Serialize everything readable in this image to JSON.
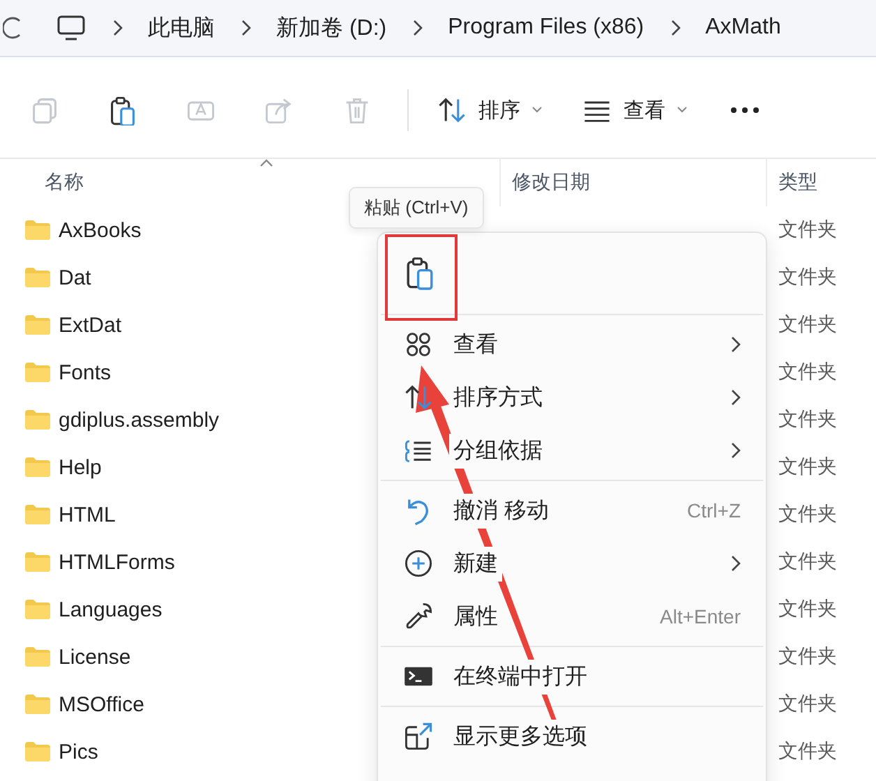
{
  "address_bar": {
    "crumbs": [
      "此电脑",
      "新加卷 (D:)",
      "Program Files (x86)",
      "AxMath"
    ]
  },
  "toolbar": {
    "items": [
      {
        "kind": "copy",
        "disabled": true
      },
      {
        "kind": "paste",
        "disabled": false
      },
      {
        "kind": "rename",
        "disabled": true
      },
      {
        "kind": "share",
        "disabled": true
      },
      {
        "kind": "delete",
        "disabled": true
      },
      {
        "kind": "sort",
        "label": "排序"
      },
      {
        "kind": "view",
        "label": "查看"
      },
      {
        "kind": "more"
      }
    ]
  },
  "columns": [
    {
      "label": "名称",
      "sorted": true
    },
    {
      "label": "修改日期",
      "sorted": false
    },
    {
      "label": "类型",
      "sorted": false
    }
  ],
  "files": [
    {
      "name": "AxBooks",
      "type": "文件夹"
    },
    {
      "name": "Dat",
      "type": "文件夹"
    },
    {
      "name": "ExtDat",
      "type": "文件夹"
    },
    {
      "name": "Fonts",
      "type": "文件夹"
    },
    {
      "name": "gdiplus.assembly",
      "type": "文件夹"
    },
    {
      "name": "Help",
      "type": "文件夹"
    },
    {
      "name": "HTML",
      "type": "文件夹"
    },
    {
      "name": "HTMLForms",
      "type": "文件夹"
    },
    {
      "name": "Languages",
      "type": "文件夹"
    },
    {
      "name": "License",
      "type": "文件夹"
    },
    {
      "name": "MSOffice",
      "type": "文件夹"
    },
    {
      "name": "Pics",
      "type": "文件夹"
    }
  ],
  "tooltip": "粘贴 (Ctrl+V)",
  "context_menu": {
    "top_icons": [
      {
        "kind": "paste"
      }
    ],
    "groups": [
      [
        {
          "kind": "view",
          "label": "查看",
          "submenu": true
        },
        {
          "kind": "sort",
          "label": "排序方式",
          "submenu": true
        },
        {
          "kind": "group",
          "label": "分组依据",
          "submenu": true
        }
      ],
      [
        {
          "kind": "undo",
          "label": "撤消 移动",
          "shortcut": "Ctrl+Z",
          "submenu": false
        },
        {
          "kind": "new",
          "label": "新建",
          "submenu": true
        },
        {
          "kind": "properties",
          "label": "属性",
          "shortcut": "Alt+Enter",
          "submenu": false
        }
      ],
      [
        {
          "kind": "terminal",
          "label": "在终端中打开",
          "submenu": false
        }
      ],
      [
        {
          "kind": "more",
          "label": "显示更多选项",
          "submenu": false
        }
      ]
    ]
  },
  "annotations": {
    "highlight_box": true,
    "arrow": true
  }
}
